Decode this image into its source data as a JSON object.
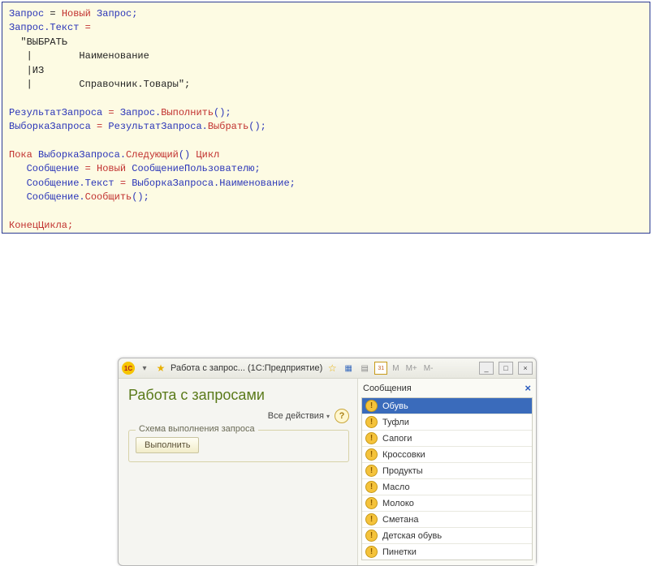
{
  "code": {
    "l1a": "Запрос",
    "l1b": " = ",
    "l1c": "Новый",
    "l1d": " Запрос;",
    "l2a": "Запрос.Текст ",
    "l2b": "=",
    "l3": "  \"ВЫБРАТЬ",
    "l4": "   |        Наименование",
    "l5": "   |ИЗ",
    "l6": "   |        Справочник.Товары\";",
    "blank1": "",
    "l7a": "РезультатЗапроса ",
    "l7b": "=",
    "l7c": " Запрос.",
    "l7d": "Выполнить",
    "l7e": "();",
    "l8a": "ВыборкаЗапроса ",
    "l8b": "=",
    "l8c": " РезультатЗапроса.",
    "l8d": "Выбрать",
    "l8e": "();",
    "blank2": "",
    "l9a": "Пока ",
    "l9b": "ВыборкаЗапроса.",
    "l9c": "Следующий",
    "l9d": "() ",
    "l9e": "Цикл",
    "l10a": "   Сообщение ",
    "l10b": "= ",
    "l10c": "Новый",
    "l10d": " СообщениеПользователю;",
    "l11a": "   Сообщение.Текст ",
    "l11b": "=",
    "l11c": " ВыборкаЗапроса.Наименование;",
    "l12a": "   Сообщение.",
    "l12b": "Сообщить",
    "l12c": "();",
    "blank3": "",
    "l13": "КонецЦикла;"
  },
  "window": {
    "logo": "1C",
    "title": "Работа с запрос... (1С:Предприятие)",
    "mem": {
      "m": "M",
      "mp": "M+",
      "mm": "M-"
    },
    "sysbtn": {
      "min": "_",
      "max": "□",
      "close": "×"
    }
  },
  "form": {
    "title": "Работа с запросами",
    "all_actions": "Все действия",
    "help": "?",
    "legend": "Схема выполнения запроса",
    "run": "Выполнить"
  },
  "messages": {
    "title": "Сообщения",
    "close": "×",
    "items": [
      {
        "text": "Обувь",
        "selected": true
      },
      {
        "text": "Туфли"
      },
      {
        "text": "Сапоги"
      },
      {
        "text": "Кроссовки"
      },
      {
        "text": "Продукты"
      },
      {
        "text": "Масло"
      },
      {
        "text": "Молоко"
      },
      {
        "text": "Сметана"
      },
      {
        "text": "Детская обувь"
      },
      {
        "text": "Пинетки"
      }
    ]
  }
}
